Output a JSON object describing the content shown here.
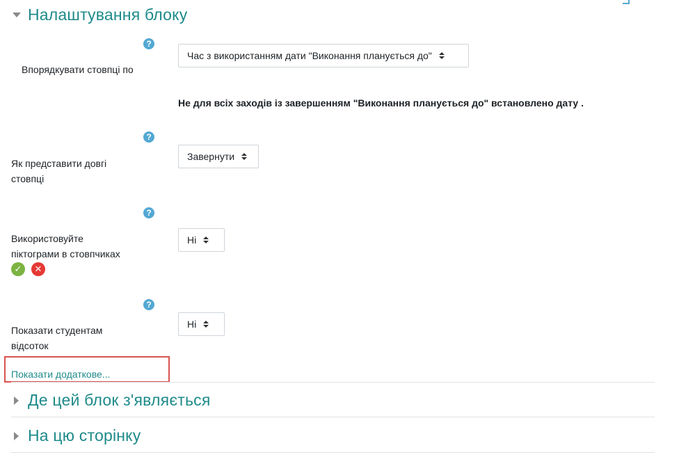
{
  "block_settings": {
    "title": "Налаштування блоку",
    "order_label": "Впорядкувати стовпці по",
    "order_value": "Час з використанням дати \"Виконання планується до\"",
    "order_notice": "Не для всіх заходів із завершенням \"Виконання планується до\" встановлено дату .",
    "long_label_line1": "Як представити довгі",
    "long_label_line2": "стовпці",
    "long_value": "Завернути",
    "icons_label_line1": "Використовуйте",
    "icons_label_line2": "піктограми в стовпчиках",
    "icons_value": "Ні",
    "percent_label_line1": "Показати студентам",
    "percent_label_line2": "відсоток",
    "percent_value": "Ні",
    "show_more": "Показати додаткове...",
    "help_glyph": "?",
    "ok_glyph": "✓",
    "x_glyph": "✕"
  },
  "sections": {
    "where_title": "Де цей блок з'являється",
    "page_title": "На цю сторінку"
  },
  "colors": {
    "accent": "#1f8a8a",
    "help": "#53a8d3",
    "highlight": "#d9534f",
    "ok": "#7cb342",
    "error": "#e53935"
  }
}
